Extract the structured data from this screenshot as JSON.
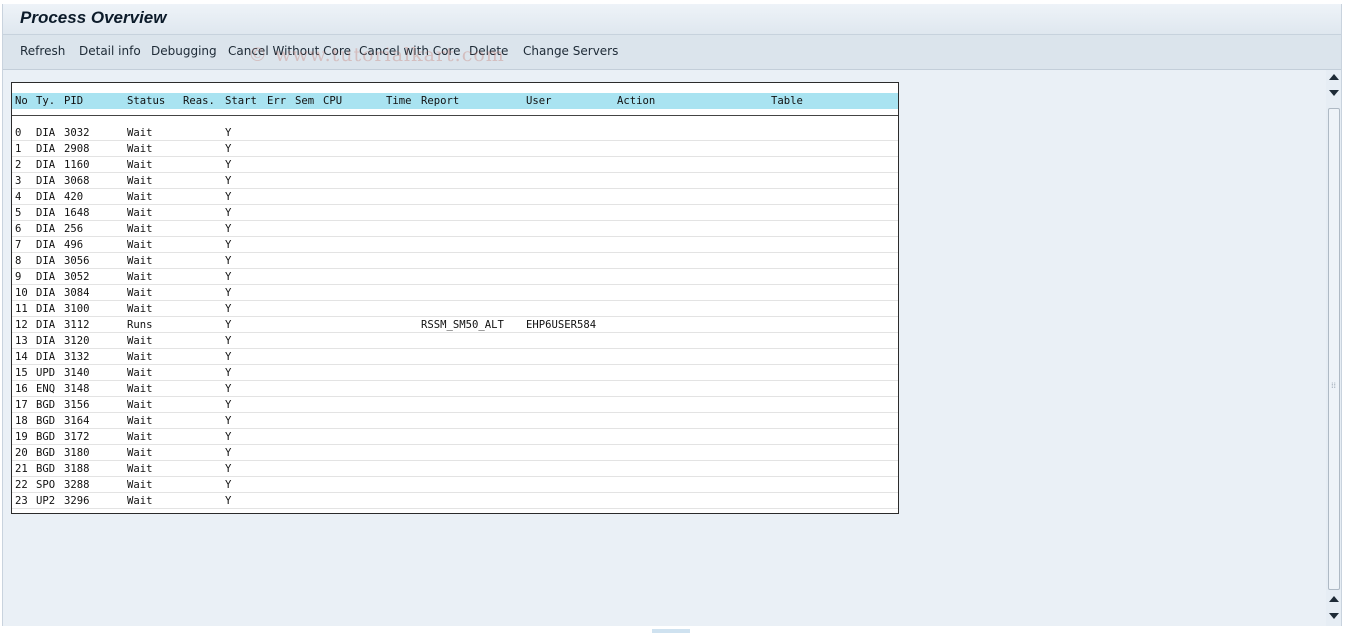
{
  "window": {
    "title": "Process Overview"
  },
  "toolbar": {
    "buttons": [
      {
        "label": "Refresh"
      },
      {
        "label": "Detail info"
      },
      {
        "label": "Debugging"
      },
      {
        "label": "Cancel Without Core"
      },
      {
        "label": "Cancel with Core"
      },
      {
        "label": "Delete"
      },
      {
        "label": "Change Servers"
      }
    ]
  },
  "watermark": "© www.tutorialkart.com",
  "table": {
    "columns": [
      "No",
      "Ty.",
      "PID",
      "Status",
      "Reas.",
      "Start",
      "Err",
      "Sem",
      "CPU",
      "Time",
      "Report",
      "User",
      "Action",
      "Table"
    ],
    "rows": [
      {
        "no": "0",
        "ty": "DIA",
        "pid": "3032",
        "status": "Wait",
        "start": "Y",
        "report": "",
        "user": ""
      },
      {
        "no": "1",
        "ty": "DIA",
        "pid": "2908",
        "status": "Wait",
        "start": "Y",
        "report": "",
        "user": ""
      },
      {
        "no": "2",
        "ty": "DIA",
        "pid": "1160",
        "status": "Wait",
        "start": "Y",
        "report": "",
        "user": ""
      },
      {
        "no": "3",
        "ty": "DIA",
        "pid": "3068",
        "status": "Wait",
        "start": "Y",
        "report": "",
        "user": ""
      },
      {
        "no": "4",
        "ty": "DIA",
        "pid": "420",
        "status": "Wait",
        "start": "Y",
        "report": "",
        "user": ""
      },
      {
        "no": "5",
        "ty": "DIA",
        "pid": "1648",
        "status": "Wait",
        "start": "Y",
        "report": "",
        "user": ""
      },
      {
        "no": "6",
        "ty": "DIA",
        "pid": "256",
        "status": "Wait",
        "start": "Y",
        "report": "",
        "user": ""
      },
      {
        "no": "7",
        "ty": "DIA",
        "pid": "496",
        "status": "Wait",
        "start": "Y",
        "report": "",
        "user": ""
      },
      {
        "no": "8",
        "ty": "DIA",
        "pid": "3056",
        "status": "Wait",
        "start": "Y",
        "report": "",
        "user": ""
      },
      {
        "no": "9",
        "ty": "DIA",
        "pid": "3052",
        "status": "Wait",
        "start": "Y",
        "report": "",
        "user": ""
      },
      {
        "no": "10",
        "ty": "DIA",
        "pid": "3084",
        "status": "Wait",
        "start": "Y",
        "report": "",
        "user": ""
      },
      {
        "no": "11",
        "ty": "DIA",
        "pid": "3100",
        "status": "Wait",
        "start": "Y",
        "report": "",
        "user": ""
      },
      {
        "no": "12",
        "ty": "DIA",
        "pid": "3112",
        "status": "Runs",
        "start": "Y",
        "report": "RSSM_SM50_ALT",
        "user": "EHP6USER584"
      },
      {
        "no": "13",
        "ty": "DIA",
        "pid": "3120",
        "status": "Wait",
        "start": "Y",
        "report": "",
        "user": ""
      },
      {
        "no": "14",
        "ty": "DIA",
        "pid": "3132",
        "status": "Wait",
        "start": "Y",
        "report": "",
        "user": ""
      },
      {
        "no": "15",
        "ty": "UPD",
        "pid": "3140",
        "status": "Wait",
        "start": "Y",
        "report": "",
        "user": ""
      },
      {
        "no": "16",
        "ty": "ENQ",
        "pid": "3148",
        "status": "Wait",
        "start": "Y",
        "report": "",
        "user": ""
      },
      {
        "no": "17",
        "ty": "BGD",
        "pid": "3156",
        "status": "Wait",
        "start": "Y",
        "report": "",
        "user": ""
      },
      {
        "no": "18",
        "ty": "BGD",
        "pid": "3164",
        "status": "Wait",
        "start": "Y",
        "report": "",
        "user": ""
      },
      {
        "no": "19",
        "ty": "BGD",
        "pid": "3172",
        "status": "Wait",
        "start": "Y",
        "report": "",
        "user": ""
      },
      {
        "no": "20",
        "ty": "BGD",
        "pid": "3180",
        "status": "Wait",
        "start": "Y",
        "report": "",
        "user": ""
      },
      {
        "no": "21",
        "ty": "BGD",
        "pid": "3188",
        "status": "Wait",
        "start": "Y",
        "report": "",
        "user": ""
      },
      {
        "no": "22",
        "ty": "SPO",
        "pid": "3288",
        "status": "Wait",
        "start": "Y",
        "report": "",
        "user": ""
      },
      {
        "no": "23",
        "ty": "UP2",
        "pid": "3296",
        "status": "Wait",
        "start": "Y",
        "report": "",
        "user": ""
      }
    ]
  },
  "scrollbar": {
    "up_icon": "arrow-up-icon",
    "down_icon": "arrow-down-icon",
    "grip": "⁞⁞"
  }
}
